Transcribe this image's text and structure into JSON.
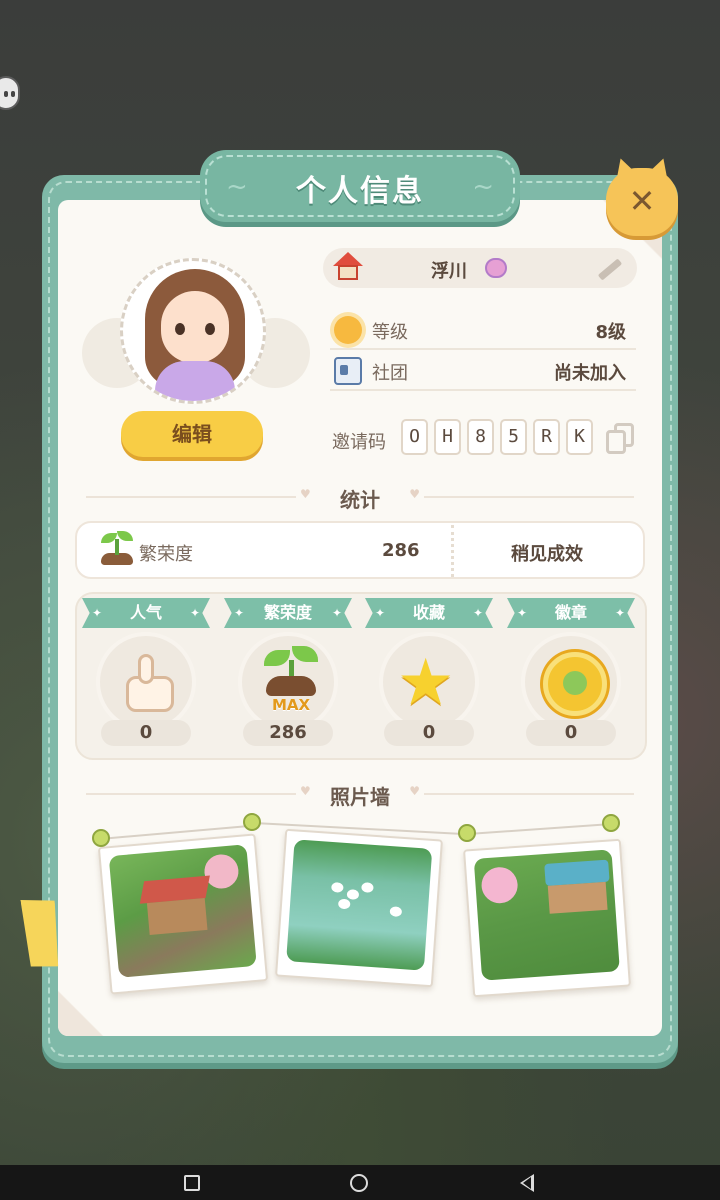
{
  "panel": {
    "title": "个人信息",
    "close_icon": "close-icon"
  },
  "profile": {
    "name": "浮川",
    "edit_label": "编辑",
    "level_label": "等级",
    "level_value": "8级",
    "club_label": "社团",
    "club_value": "尚未加入",
    "invite_label": "邀请码",
    "invite_code": [
      "O",
      "H",
      "8",
      "5",
      "R",
      "K"
    ]
  },
  "stats": {
    "section_title": "统计",
    "prosperity_label": "繁荣度",
    "prosperity_value": "286",
    "prosperity_status": "稍见成效",
    "items": [
      {
        "label": "人气",
        "value": "0",
        "icon": "thumbs-up-icon"
      },
      {
        "label": "繁荣度",
        "value": "286",
        "icon": "sprout-max-icon",
        "badge": "MAX"
      },
      {
        "label": "收藏",
        "value": "0",
        "icon": "star-icon"
      },
      {
        "label": "徽章",
        "value": "0",
        "icon": "medal-icon"
      }
    ]
  },
  "photo_wall": {
    "section_title": "照片墙",
    "photos": [
      "farm-house-photo",
      "pond-ducks-photo",
      "pavilion-garden-photo"
    ]
  },
  "colors": {
    "frame": "#7fb9a8",
    "accent_yellow": "#f8cd45",
    "paper": "#fbf9f4",
    "text_dark": "#5b4a3e"
  }
}
